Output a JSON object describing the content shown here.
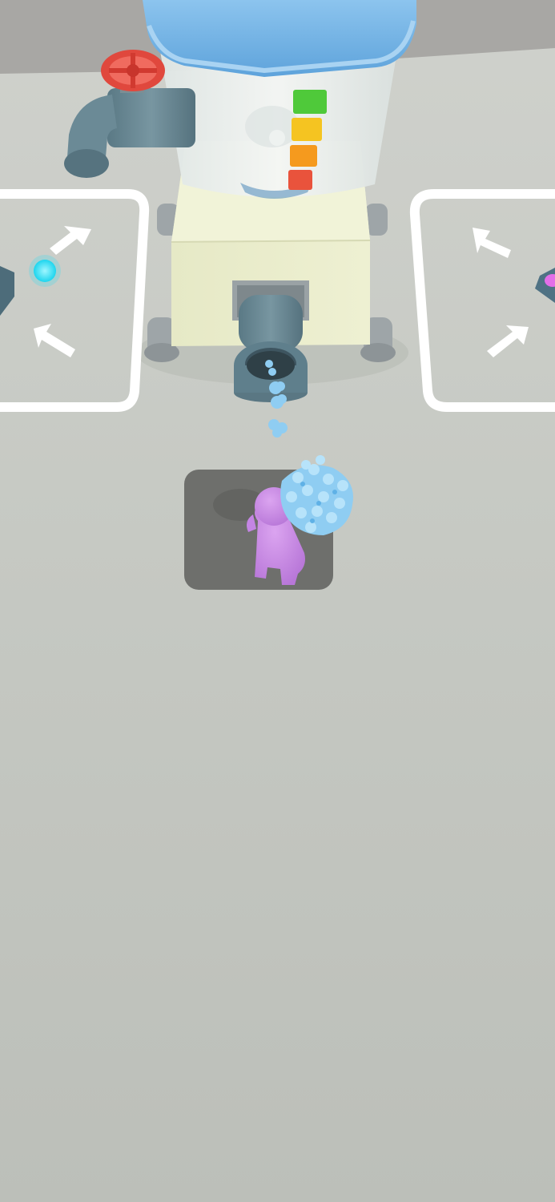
{
  "scene": {
    "type": "3d-factory-game",
    "colors": {
      "floor": "#c9ccc6",
      "back_wall": "#a9a8a6",
      "machine_body": "#eceecd",
      "tank_glass": "#e9ece9",
      "tank_cap": "#7bb8e6",
      "pipe": "#5f7f8c",
      "valve": "#e0483d",
      "player": "#c98ae6",
      "crystal": "#8fcdf2",
      "gem_cyan": "#2fe0f4",
      "gem_magenta": "#e36ee8",
      "zone_outline": "#ffffff",
      "pad": "#6e6f6c"
    },
    "fill_meter": {
      "segments": [
        "#4fc93a",
        "#f5c421",
        "#f59a1e",
        "#e9533c"
      ],
      "level": 1.0
    },
    "left_zone": {
      "icon": "inward-arrows-icon",
      "item": "cyan-gem"
    },
    "right_zone": {
      "icon": "inward-arrows-icon",
      "item": "magenta-gem"
    },
    "player": {
      "carrying": "crystal-stack"
    }
  }
}
